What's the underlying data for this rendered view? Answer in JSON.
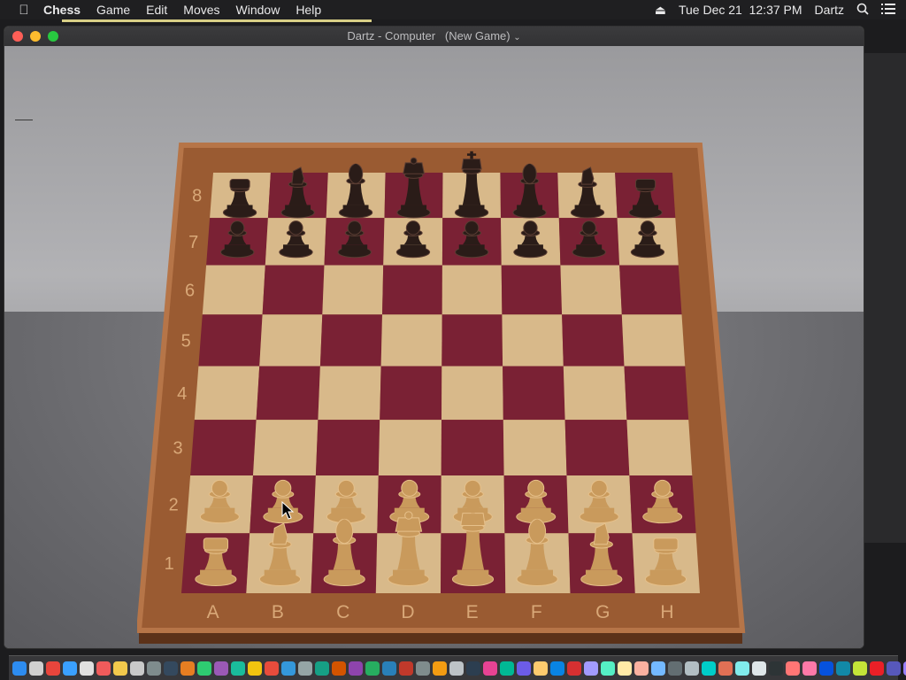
{
  "menubar": {
    "apple_icon": "apple-icon",
    "app_name": "Chess",
    "menus": [
      "Game",
      "Edit",
      "Moves",
      "Window",
      "Help"
    ],
    "date": "Tue Dec 21",
    "time": "12:37 PM",
    "user": "Dartz"
  },
  "window": {
    "title": "Dartz - Computer",
    "subtitle": "(New Game)"
  },
  "board": {
    "files": [
      "A",
      "B",
      "C",
      "D",
      "E",
      "F",
      "G",
      "H"
    ],
    "ranks": [
      "8",
      "7",
      "6",
      "5",
      "4",
      "3",
      "2",
      "1"
    ],
    "light_color": "#d8b98a",
    "dark_color": "#7a2134",
    "frame_color": "#9a5b32",
    "black_pieces": [
      "rook",
      "knight",
      "bishop",
      "queen",
      "king",
      "bishop",
      "knight",
      "rook"
    ],
    "white_pieces": [
      "rook",
      "knight",
      "bishop",
      "queen",
      "king",
      "bishop",
      "knight",
      "rook"
    ]
  },
  "colors": {
    "white_piece": "#c99a5c",
    "black_piece": "#2a1c18"
  }
}
